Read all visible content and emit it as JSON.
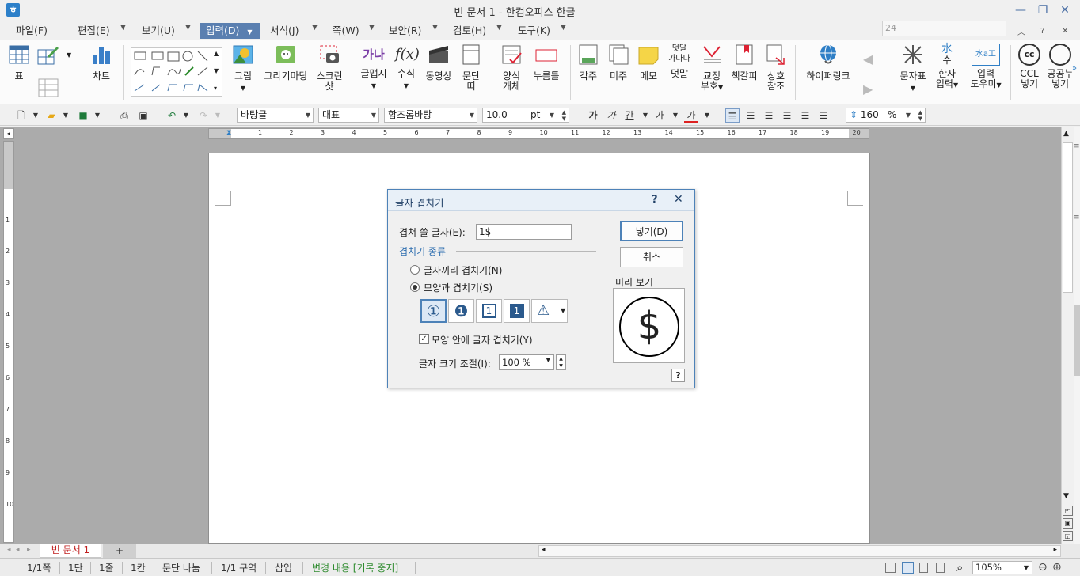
{
  "window": {
    "title": "빈 문서 1 - 한컴오피스 한글",
    "font_size_box": "24"
  },
  "menu": [
    "파일(F)",
    "편집(E)",
    "보기(U)",
    "입력(D)",
    "서식(J)",
    "쪽(W)",
    "보안(R)",
    "검토(H)",
    "도구(K)"
  ],
  "ribbon": {
    "table": "표",
    "chart": "차트",
    "picture": "그림",
    "draw_mart": "그리기마당",
    "screenshot_1": "스크린",
    "screenshot_2": "샷",
    "glyph": "글맵시",
    "glyph_text": "가나",
    "equation": "수식",
    "equation_text": "f(x)",
    "video": "동영상",
    "para_1": "문단",
    "para_2": "띠",
    "form_1": "양식",
    "form_2": "개체",
    "button": "누름틀",
    "footnote": "각주",
    "endnote": "미주",
    "memo": "메모",
    "overlap": "덧말",
    "overlap_icon_1": "덧말",
    "overlap_icon_2": "가나다",
    "proof_1": "교정",
    "proof_2": "부호",
    "bookmark": "책갈피",
    "xref_1": "상호",
    "xref_2": "참조",
    "hyperlink": "하이퍼링크",
    "symbol": "문자표",
    "hanja_1": "한자",
    "hanja_2": "입력",
    "hanja_icon_1": "水",
    "hanja_icon_2": "수",
    "helper_1": "입력",
    "helper_2": "도우미",
    "helper_icon": "水a工",
    "ccl_1": "CCL",
    "ccl_2": "넣기",
    "ccl_icon": "cc",
    "public_1": "공공누",
    "public_2": "넣기"
  },
  "format": {
    "style": "바탕글",
    "lang": "대표",
    "font": "함초롬바탕",
    "size": "10.0",
    "unit": "pt",
    "zoom": "160",
    "percent": "%",
    "bold": "가",
    "italic": "가",
    "underline": "간",
    "strike": "가",
    "color": "가"
  },
  "ruler": {
    "h": [
      "1",
      "2",
      "3",
      "4",
      "5",
      "6",
      "7",
      "8",
      "9",
      "10",
      "11",
      "12",
      "13",
      "14",
      "15",
      "16",
      "17",
      "18",
      "19",
      "20"
    ],
    "v": [
      "1",
      "2",
      "3",
      "4",
      "5",
      "6",
      "7",
      "8",
      "9",
      "10"
    ]
  },
  "dialog": {
    "title": "글자 겹치기",
    "help": "?",
    "close": "✕",
    "overlap_label": "겹쳐 쓸 글자(E):",
    "overlap_value": "1$",
    "insert_button": "넣기(D)",
    "cancel_button": "취소",
    "type_group": "겹치기 종류",
    "radio_chars": "글자끼리 겹치기(N)",
    "radio_shape": "모양과 겹치기(S)",
    "shapes": [
      "①",
      "❶",
      "1",
      "1",
      "⚠"
    ],
    "inside_check": "모양 안에 글자 겹치기(Y)",
    "size_label": "글자 크기 조절(I):",
    "size_value": "100 %",
    "preview_label": "미리 보기",
    "preview_char": "$",
    "help_small": "?"
  },
  "tab": {
    "doc": "빈 문서 1",
    "add": "+"
  },
  "status": [
    "1/1쪽",
    "1단",
    "1줄",
    "1칸",
    "문단 나눔",
    "1/1 구역",
    "삽입",
    "변경 내용 [기록 중지]"
  ],
  "status_zoom": "105%",
  "colors": {
    "accent": "#4d82b8",
    "menu_active": "#5a7fb0",
    "status_green": "#2e8b2e"
  }
}
